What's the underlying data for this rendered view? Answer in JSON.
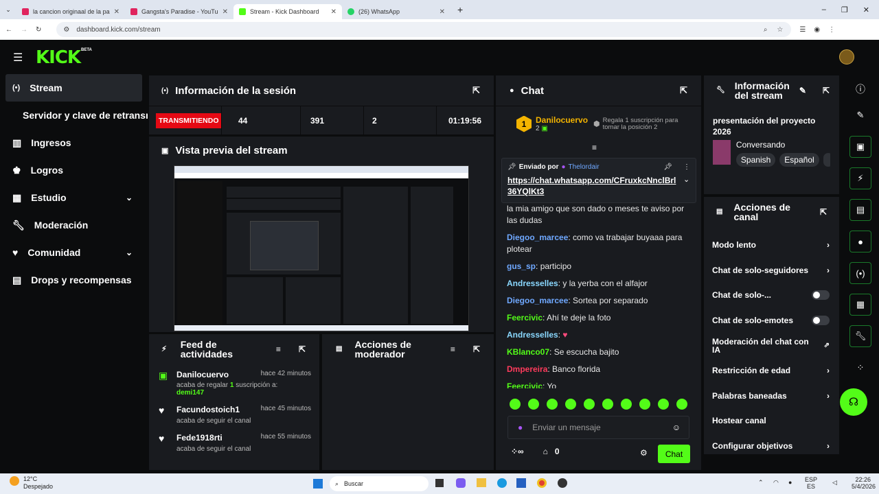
{
  "browser": {
    "tabs": [
      {
        "title": "la cancion originaal de la pant",
        "color": "#e0245e"
      },
      {
        "title": "Gangsta's Paradise - YouTube",
        "color": "#e0245e"
      },
      {
        "title": "Stream - Kick Dashboard",
        "color": "#53fc18"
      },
      {
        "title": "(26) WhatsApp",
        "color": "#25d366"
      }
    ],
    "url": "dashboard.kick.com/stream"
  },
  "brand": {
    "logo": "KICK",
    "badge": "BETA",
    "accent": "#53fc18"
  },
  "sidebar": {
    "items": [
      {
        "label": "Stream",
        "icon": "stream-icon"
      },
      {
        "label": "Servidor y clave de retransm",
        "icon": ""
      },
      {
        "label": "Ingresos",
        "icon": "revenue-icon"
      },
      {
        "label": "Logros",
        "icon": "trophy-icon"
      },
      {
        "label": "Estudio",
        "icon": "studio-icon"
      },
      {
        "label": "Moderación",
        "icon": "wrench-icon"
      },
      {
        "label": "Comunidad",
        "icon": "community-icon"
      },
      {
        "label": "Drops y recompensas",
        "icon": "gift-icon"
      }
    ]
  },
  "session": {
    "title": "Información de la sesión",
    "status": "TRANSMITIENDO",
    "stats": [
      "44",
      "391",
      "2",
      "01:19:56"
    ]
  },
  "preview": {
    "title": "Vista previa del stream"
  },
  "feed": {
    "title_line1": "Feed de",
    "title_line2": "actividades",
    "items": [
      {
        "user": "Danilocuervo",
        "time": "hace 42 minutos",
        "desc": "acaba de regalar",
        "count": "1",
        "desc2": "suscripción a:",
        "target": "demi147"
      },
      {
        "user": "Facundostoich1",
        "time": "hace 45 minutos",
        "desc": "acaba de seguir el canal"
      },
      {
        "user": "Fede1918rti",
        "time": "hace 55 minutos",
        "desc": "acaba de seguir el canal"
      }
    ]
  },
  "modactions": {
    "title_line1": "Acciones de",
    "title_line2": "moderador"
  },
  "chat": {
    "title": "Chat",
    "top_gifter": {
      "rank": "1",
      "user": "Danilocuervo",
      "count": "2",
      "promo": "Regala 1 suscripción para tomar la posición 2"
    },
    "pinned": {
      "label": "Enviado por",
      "user": "Thelordair",
      "link": "https://chat.whatsapp.com/CFruxkcNnclBrl36YQlKt3",
      "overflow": "la mia amigo que son dado o meses te aviso por las dudas"
    },
    "messages": [
      {
        "user": "Diegoo_marcee",
        "color": "#6fa8ff",
        "text": "como va trabajar buyaaa para plotear"
      },
      {
        "user": "gus_sp",
        "color": "#6fa8ff",
        "text": "participo"
      },
      {
        "user": "Andresselles",
        "color": "#8ad8ff",
        "text": "y la yerba con el alfajor"
      },
      {
        "user": "Diegoo_marcee",
        "color": "#6fa8ff",
        "text": "Sortea por separado"
      },
      {
        "user": "Feercivic",
        "color": "#53fc18",
        "text": "Ahí te deje la foto"
      },
      {
        "user": "Andresselles",
        "color": "#8ad8ff",
        "text": "♥"
      },
      {
        "user": "KBlanco07",
        "color": "#53fc18",
        "text": "Se escucha bajito"
      },
      {
        "user": "Dmpereira",
        "color": "#ff3b5c",
        "text": "Banco florida"
      },
      {
        "user": "Feercivic",
        "color": "#53fc18",
        "text": "Yo"
      }
    ],
    "input_placeholder": "Enviar un mensaje",
    "points": "0",
    "send_label": "Chat"
  },
  "streaminfo": {
    "title_line1": "Información",
    "title_line2": "del stream",
    "stream_title": "presentación del proyecto 2026",
    "category": "Conversando",
    "tags": [
      "Spanish",
      "Español"
    ]
  },
  "channelactions": {
    "title_line1": "Acciones de",
    "title_line2": "canal",
    "items": [
      {
        "label": "Modo lento",
        "control": "chevron"
      },
      {
        "label": "Chat de solo-seguidores",
        "control": "chevron"
      },
      {
        "label": "Chat de solo-...",
        "control": "toggle"
      },
      {
        "label": "Chat de solo-emotes",
        "control": "toggle"
      },
      {
        "label": "Moderación del chat con IA",
        "control": "external"
      },
      {
        "label": "Restricción de edad",
        "control": "chevron"
      },
      {
        "label": "Palabras baneadas",
        "control": "chevron"
      },
      {
        "label": "Hostear canal",
        "control": "none"
      },
      {
        "label": "Configurar objetivos",
        "control": "chevron"
      }
    ]
  },
  "taskbar": {
    "weather_temp": "12°C",
    "weather_desc": "Despejado",
    "search": "Buscar",
    "lang": "ESP",
    "lang2": "ES",
    "time": "22:26",
    "date": "5/4/2026"
  }
}
